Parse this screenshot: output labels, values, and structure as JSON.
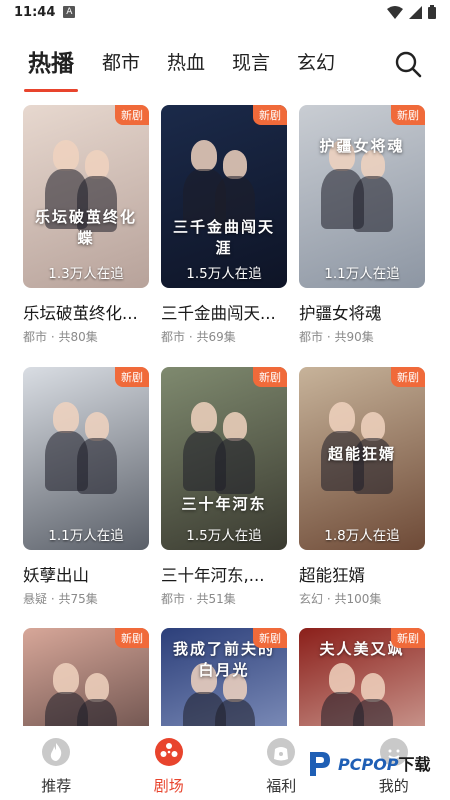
{
  "status_bar": {
    "time": "11:44",
    "notification_letter": "A"
  },
  "tabs": [
    {
      "label": "热播",
      "active": true
    },
    {
      "label": "都市",
      "active": false
    },
    {
      "label": "热血",
      "active": false
    },
    {
      "label": "现言",
      "active": false
    },
    {
      "label": "玄幻",
      "active": false
    }
  ],
  "badge_label": "新剧",
  "cards": [
    {
      "title": "乐坛破茧终化...",
      "meta": "都市 · 共80集",
      "views": "1.3万人在追",
      "poster_text": "乐坛破茧终化蝶",
      "colors": [
        "#e7d8cf",
        "#b7a29a"
      ]
    },
    {
      "title": "三千金曲闯天...",
      "meta": "都市 · 共69集",
      "views": "1.5万人在追",
      "poster_text": "三千金曲闯天涯",
      "colors": [
        "#1b2a4a",
        "#0e1426"
      ]
    },
    {
      "title": "护疆女将魂",
      "meta": "都市 · 共90集",
      "views": "1.1万人在追",
      "poster_text": "护疆女将魂",
      "colors": [
        "#c9cdd3",
        "#8d96a3"
      ]
    },
    {
      "title": "妖孽出山",
      "meta": "悬疑 · 共75集",
      "views": "1.1万人在追",
      "poster_text": "",
      "colors": [
        "#d9dde3",
        "#5a5f68"
      ]
    },
    {
      "title": "三十年河东,...",
      "meta": "都市 · 共51集",
      "views": "1.5万人在追",
      "poster_text": "三十年河东",
      "colors": [
        "#7f8a6f",
        "#3a3a30"
      ]
    },
    {
      "title": "超能狂婿",
      "meta": "玄幻 · 共100集",
      "views": "1.8万人在追",
      "poster_text": "超能狂婿",
      "colors": [
        "#c7b39a",
        "#6e4a37"
      ]
    },
    {
      "title": "",
      "meta": "",
      "views": "",
      "poster_text": "",
      "colors": [
        "#d7a799",
        "#3b2a2a"
      ]
    },
    {
      "title": "",
      "meta": "",
      "views": "",
      "poster_text": "我成了前夫的白月光",
      "colors": [
        "#2c3f7a",
        "#a6b4d8"
      ]
    },
    {
      "title": "",
      "meta": "",
      "views": "",
      "poster_text": "夫人美又飒",
      "colors": [
        "#8b1f1a",
        "#e9d4c9"
      ]
    }
  ],
  "bottom_nav": [
    {
      "label": "推荐",
      "icon": "flame-icon",
      "active": false
    },
    {
      "label": "剧场",
      "icon": "film-reel-icon",
      "active": true
    },
    {
      "label": "福利",
      "icon": "gift-bag-icon",
      "active": false
    },
    {
      "label": "我的",
      "icon": "profile-icon",
      "active": false
    }
  ],
  "watermark": {
    "brand": "PCPOP",
    "suffix": "下载"
  },
  "accent_color": "#e8442d",
  "badge_color": "#f06a3a"
}
